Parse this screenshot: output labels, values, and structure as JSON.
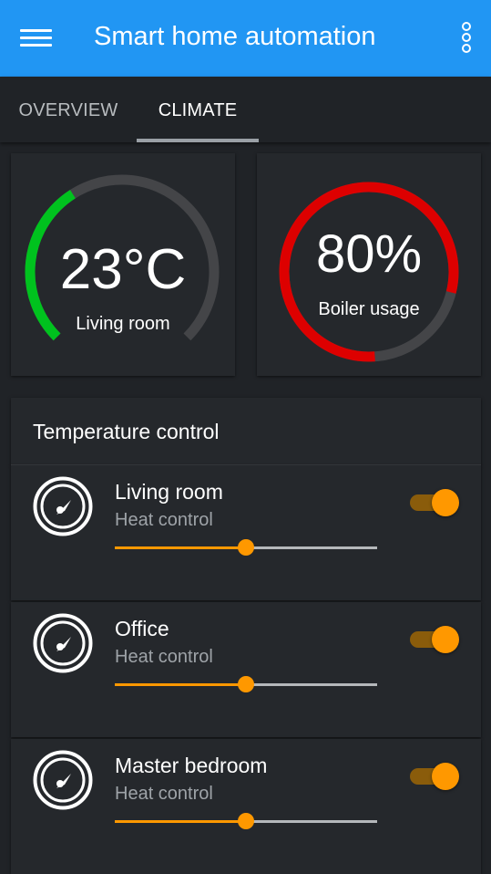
{
  "appbar": {
    "title": "Smart home automation",
    "menu_icon": "hamburger-menu-icon",
    "overflow_icon": "more-vertical-icon",
    "color": "#2196f3"
  },
  "tabs": [
    {
      "label": "OVERVIEW",
      "selected": false
    },
    {
      "label": "CLIMATE",
      "selected": true
    }
  ],
  "gauges": [
    {
      "value": "23°C",
      "label": "Living room",
      "fraction": 0.38,
      "color": "#00c21e"
    },
    {
      "value": "80%",
      "label": "Boiler usage",
      "fraction": 0.8,
      "color": "#dd0000"
    }
  ],
  "temperature_control": {
    "title": "Temperature control",
    "rooms": [
      {
        "name": "Living room",
        "subtitle": "Heat control",
        "slider": 0.5,
        "enabled": true,
        "icon": "gauge-icon"
      },
      {
        "name": "Office",
        "subtitle": "Heat control",
        "slider": 0.5,
        "enabled": true,
        "icon": "gauge-icon"
      },
      {
        "name": "Master bedroom",
        "subtitle": "Heat control",
        "slider": 0.5,
        "enabled": true,
        "icon": "gauge-icon"
      }
    ]
  },
  "colors": {
    "accent": "#ff9800",
    "background": "#202327",
    "card": "#25282c",
    "gauge_track": "#444548"
  }
}
